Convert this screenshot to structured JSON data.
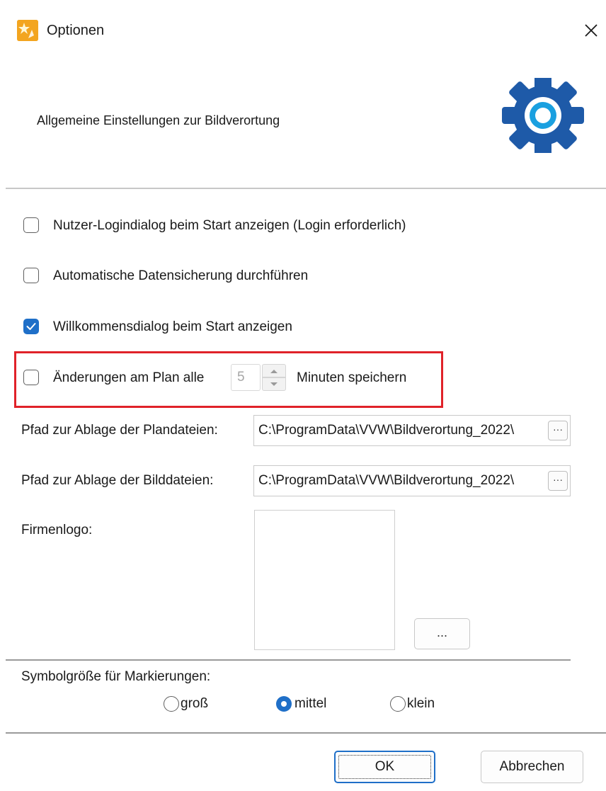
{
  "window": {
    "title": "Optionen",
    "header_text": "Allgemeine Einstellungen zur Bildverortung"
  },
  "options": {
    "login_dialog": {
      "label": "Nutzer-Logindialog beim Start anzeigen (Login erforderlich)",
      "checked": false
    },
    "auto_backup": {
      "label": "Automatische Datensicherung durchführen",
      "checked": false
    },
    "welcome_dialog": {
      "label": "Willkommensdialog beim Start anzeigen",
      "checked": true
    },
    "save_plan": {
      "label_before": "Änderungen am Plan alle",
      "interval_value": "5",
      "label_after": "Minuten speichern",
      "checked": false
    }
  },
  "paths": {
    "plan_files": {
      "label": "Pfad zur Ablage der Plandateien:",
      "value": "C:\\ProgramData\\VVW\\Bildverortung_2022\\",
      "browse_label": "···"
    },
    "image_files": {
      "label": "Pfad zur Ablage der Bilddateien:",
      "value": "C:\\ProgramData\\VVW\\Bildverortung_2022\\",
      "browse_label": "···"
    }
  },
  "logo": {
    "label": "Firmenlogo:",
    "browse_label": "..."
  },
  "symbol_size": {
    "label": "Symbolgröße für Markierungen:",
    "options": [
      {
        "label": "groß",
        "selected": false
      },
      {
        "label": "mittel",
        "selected": true
      },
      {
        "label": "klein",
        "selected": false
      }
    ]
  },
  "buttons": {
    "ok": "OK",
    "cancel": "Abbrechen"
  },
  "colors": {
    "accent": "#1f6fc8",
    "gear": "#1e5aa8",
    "highlight_box": "#e02229",
    "app_icon": "#f3a51f"
  },
  "icons": {
    "app": "star-doc-icon",
    "close": "close-icon",
    "header": "gear-icon"
  }
}
